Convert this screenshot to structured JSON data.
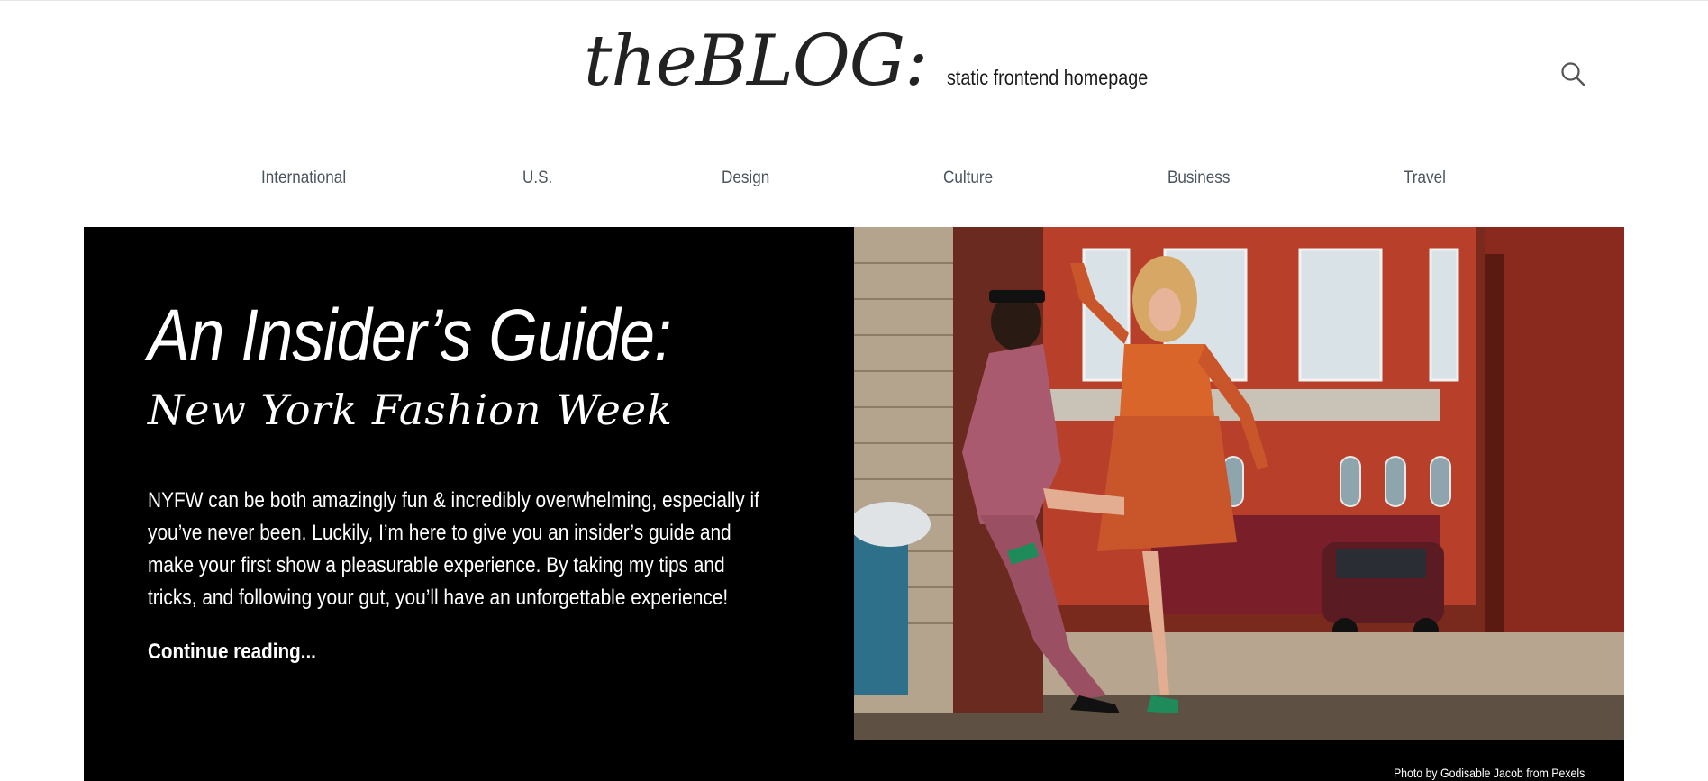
{
  "site": {
    "logo": "theBLOG:",
    "tagline": "static frontend homepage"
  },
  "nav": {
    "items": [
      {
        "label": "International"
      },
      {
        "label": "U.S."
      },
      {
        "label": "Design"
      },
      {
        "label": "Culture"
      },
      {
        "label": "Business"
      },
      {
        "label": "Travel"
      }
    ]
  },
  "hero": {
    "headline": "An Insider’s Guide:",
    "subhead": "New York Fashion Week",
    "excerpt": "NYFW can be both amazingly fun & incredibly overwhelming, especially if you’ve never been. Luckily, I’m here to give you an insider’s guide and make your first show a pleasurable experience. By taking my tips and tricks, and following your gut, you’ll have an unforgettable experience!",
    "continue_label": "Continue reading...",
    "photo_credit": "Photo by Godisable Jacob from Pexels"
  },
  "icons": {
    "search": "search-icon"
  },
  "colors": {
    "hero_background": "#000000",
    "nav_text": "#4a5560",
    "logo_text": "#222222"
  }
}
